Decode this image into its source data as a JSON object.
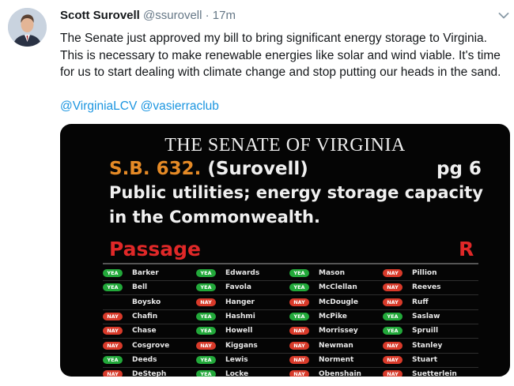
{
  "tweet": {
    "name": "Scott Surovell",
    "handle": "@ssurovell",
    "separator": "·",
    "time": "17m",
    "text": "The Senate just approved my bill to bring significant energy storage to Virginia. This is necessary to make renewable energies like solar and wind viable. It's time for us to start dealing with climate change and stop putting our heads in the sand.",
    "mentions": [
      "@VirginiaLCV",
      "@vasierraclub"
    ]
  },
  "icons": {
    "avatar": "avatar-photo",
    "menu": "chevron-down-icon"
  },
  "colors": {
    "link": "#1b95e0",
    "yea": "#22a83a",
    "nay": "#d83a2a",
    "bill": "#e58a26",
    "passage": "#e02828"
  },
  "vote_board": {
    "title": "THE SENATE OF VIRGINIA",
    "bill_number": "S.B. 632.",
    "patron": "(Surovell)",
    "page": "pg 6",
    "description": "Public utilities; energy storage capacity in the Commonwealth.",
    "passage_label": "Passage",
    "result_marker": "R",
    "columns": [
      [
        {
          "vote": "YEA",
          "name": "Barker"
        },
        {
          "vote": "YEA",
          "name": "Bell"
        },
        {
          "vote": "",
          "name": "Boysko"
        },
        {
          "vote": "NAY",
          "name": "Chafin"
        },
        {
          "vote": "NAY",
          "name": "Chase"
        },
        {
          "vote": "NAY",
          "name": "Cosgrove"
        },
        {
          "vote": "YEA",
          "name": "Deeds"
        },
        {
          "vote": "NAY",
          "name": "DeSteph"
        }
      ],
      [
        {
          "vote": "YEA",
          "name": "Edwards"
        },
        {
          "vote": "YEA",
          "name": "Favola"
        },
        {
          "vote": "NAY",
          "name": "Hanger"
        },
        {
          "vote": "YEA",
          "name": "Hashmi"
        },
        {
          "vote": "YEA",
          "name": "Howell"
        },
        {
          "vote": "NAY",
          "name": "Kiggans"
        },
        {
          "vote": "YEA",
          "name": "Lewis"
        },
        {
          "vote": "YEA",
          "name": "Locke"
        }
      ],
      [
        {
          "vote": "YEA",
          "name": "Mason"
        },
        {
          "vote": "YEA",
          "name": "McClellan"
        },
        {
          "vote": "NAY",
          "name": "McDougle"
        },
        {
          "vote": "YEA",
          "name": "McPike"
        },
        {
          "vote": "NAY",
          "name": "Morrissey"
        },
        {
          "vote": "NAY",
          "name": "Newman"
        },
        {
          "vote": "NAY",
          "name": "Norment"
        },
        {
          "vote": "NAY",
          "name": "Obenshain"
        }
      ],
      [
        {
          "vote": "NAY",
          "name": "Pillion"
        },
        {
          "vote": "NAY",
          "name": "Reeves"
        },
        {
          "vote": "NAY",
          "name": "Ruff"
        },
        {
          "vote": "YEA",
          "name": "Saslaw"
        },
        {
          "vote": "YEA",
          "name": "Spruill"
        },
        {
          "vote": "NAY",
          "name": "Stanley"
        },
        {
          "vote": "NAY",
          "name": "Stuart"
        },
        {
          "vote": "NAY",
          "name": "Suetterlein"
        }
      ]
    ]
  }
}
